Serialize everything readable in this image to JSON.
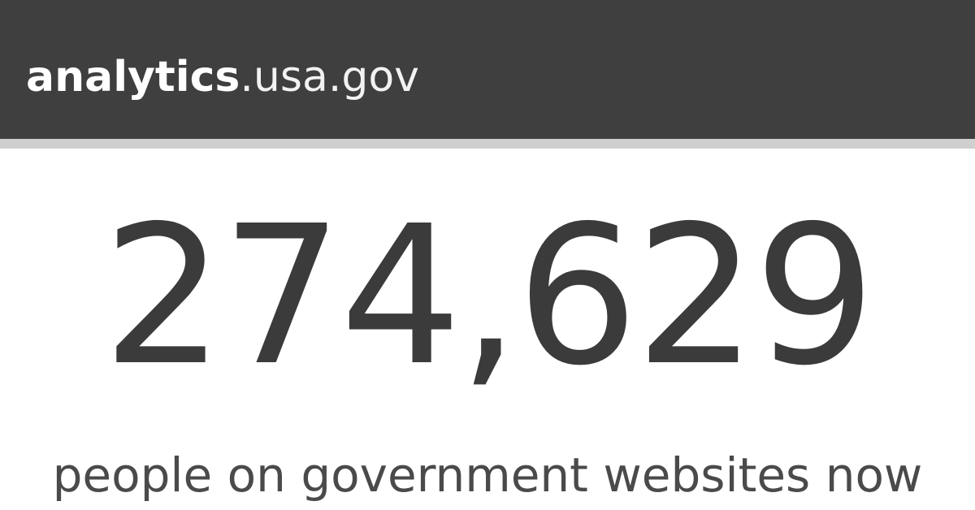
{
  "header": {
    "logo_bold": "analytics",
    "logo_light": ".usa.gov"
  },
  "main": {
    "visitor_count": "274,629",
    "caption": "people on government websites now"
  },
  "colors": {
    "header_bg": "#3f3f3f",
    "header_border": "#cfcfcf",
    "text_dark": "#3b3b3b",
    "page_bg": "#ffffff"
  }
}
